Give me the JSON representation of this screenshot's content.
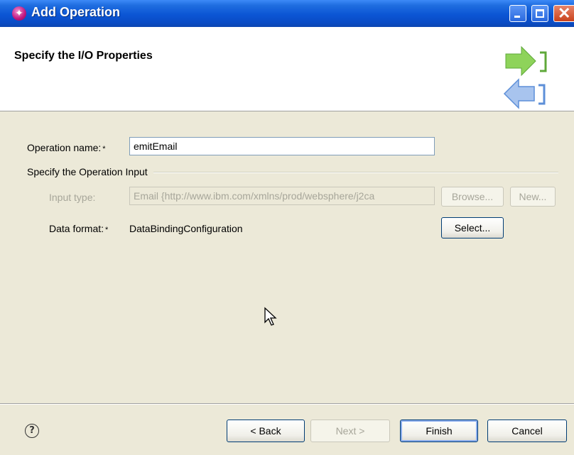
{
  "window": {
    "title": "Add Operation",
    "controls": [
      "minimize",
      "maximize",
      "close"
    ]
  },
  "banner": {
    "title": "Specify the I/O Properties"
  },
  "form": {
    "operation_name_label": "Operation name:",
    "required_mark": "*",
    "operation_name_value": "emitEmail",
    "group_title": "Specify the Operation Input",
    "input_type_label": "Input type:",
    "input_type_value": "Email  {http://www.ibm.com/xmlns/prod/websphere/j2ca",
    "browse_label": "Browse...",
    "new_label": "New...",
    "data_format_label": "Data format:",
    "data_format_value": "DataBindingConfiguration",
    "select_label": "Select..."
  },
  "footer": {
    "help_icon": "?",
    "back_label": "< Back",
    "next_label": "Next >",
    "finish_label": "Finish",
    "cancel_label": "Cancel"
  },
  "colors": {
    "titlebar": "#0b55d4",
    "dialog_bg": "#ece9d8",
    "disabled_text": "#a7a69a",
    "wizard_arrow_green": "#7cc84a",
    "wizard_arrow_blue": "#5d8fd8"
  }
}
